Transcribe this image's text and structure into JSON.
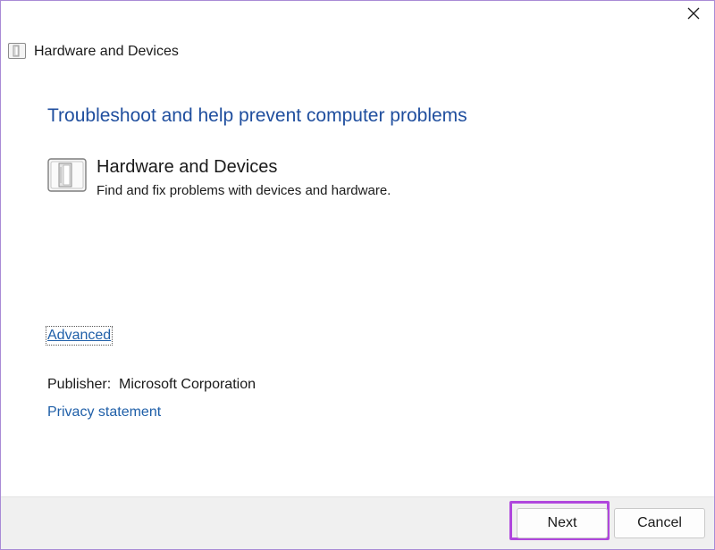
{
  "window": {
    "title": "Hardware and Devices",
    "close_icon": "close-icon"
  },
  "main": {
    "heading": "Troubleshoot and help prevent computer problems",
    "item": {
      "icon": "hardware-device-icon",
      "title": "Hardware and Devices",
      "description": "Find and fix problems with devices and hardware."
    },
    "advanced_label": "Advanced",
    "publisher_label": "Publisher:",
    "publisher_value": "Microsoft Corporation",
    "privacy_label": "Privacy statement"
  },
  "footer": {
    "next_label": "Next",
    "cancel_label": "Cancel"
  },
  "colors": {
    "heading": "#1f4e9e",
    "link": "#1f5fa8",
    "highlight": "#b047dd",
    "window_border": "#a98bd6",
    "footer_bg": "#f0f0f0"
  }
}
